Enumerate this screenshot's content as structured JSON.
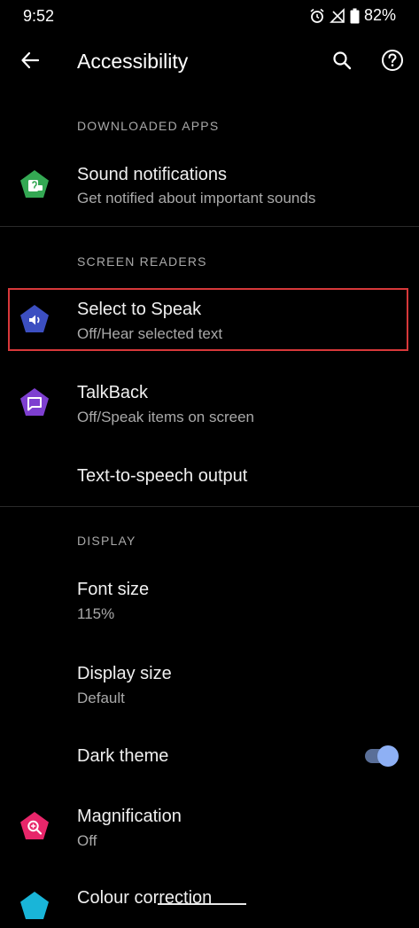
{
  "status_bar": {
    "time": "9:52",
    "battery": "82%",
    "icons": [
      "alarm-icon",
      "signal-off-icon",
      "battery-icon"
    ]
  },
  "app_bar": {
    "title": "Accessibility",
    "icons": [
      "back-arrow-icon",
      "search-icon",
      "help-icon"
    ]
  },
  "sections": {
    "downloaded_apps": "DOWNLOADED APPS",
    "screen_readers": "SCREEN READERS",
    "display": "DISPLAY"
  },
  "items": {
    "sound_notifications": {
      "title": "Sound notifications",
      "subtitle": "Get notified about important sounds",
      "icon": "sound-notifications-icon",
      "icon_color": "#34a853"
    },
    "select_to_speak": {
      "title": "Select to Speak",
      "subtitle": "Off/Hear selected text",
      "icon": "select-to-speak-icon",
      "icon_color": "#3c4fc1"
    },
    "talkback": {
      "title": "TalkBack",
      "subtitle": "Off/Speak items on screen",
      "icon": "talkback-icon",
      "icon_color": "#7e3fd0"
    },
    "tts_output": {
      "title": "Text-to-speech output"
    },
    "font_size": {
      "title": "Font size",
      "subtitle": "115%"
    },
    "display_size": {
      "title": "Display size",
      "subtitle": "Default"
    },
    "dark_theme": {
      "title": "Dark theme",
      "enabled": true
    },
    "magnification": {
      "title": "Magnification",
      "subtitle": "Off",
      "icon": "magnification-icon",
      "icon_color": "#e8266a"
    },
    "colour_correction": {
      "title": "Colour correction",
      "icon": "colour-correction-icon",
      "icon_color": "#19b5d8"
    }
  },
  "colors": {
    "background": "#000000",
    "highlight": "#d8383a",
    "toggle_thumb": "#8eb0f4"
  }
}
